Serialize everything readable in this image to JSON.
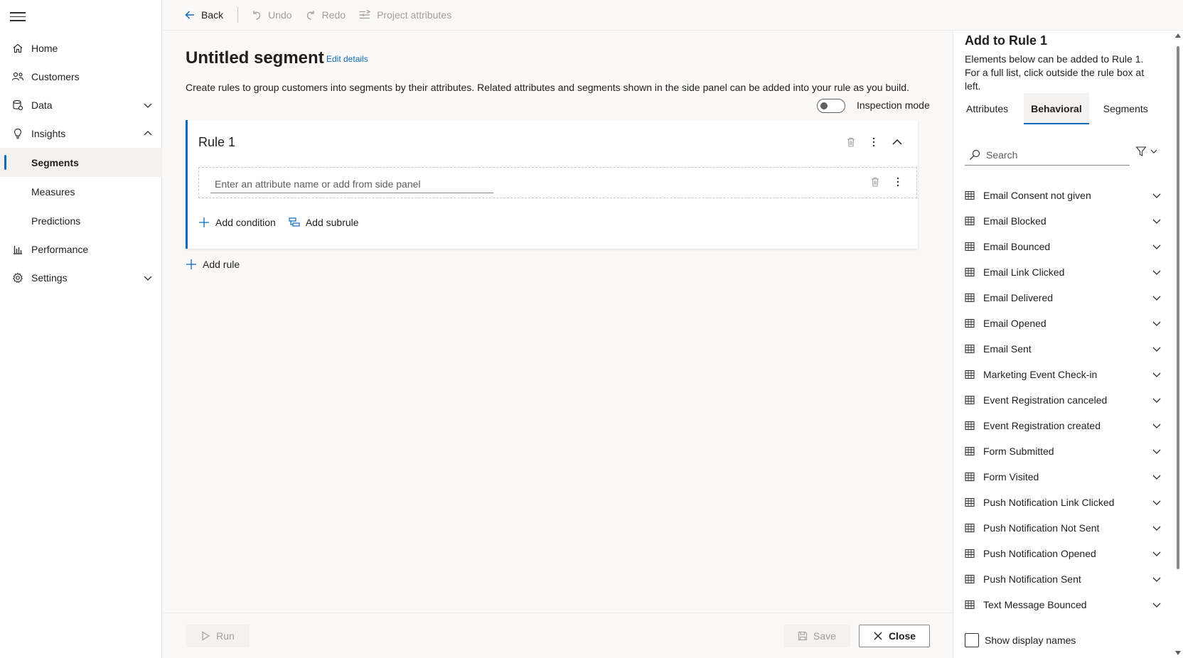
{
  "nav": {
    "items": [
      {
        "label": "Home",
        "icon": "home-icon"
      },
      {
        "label": "Customers",
        "icon": "people-icon"
      },
      {
        "label": "Data",
        "icon": "database-icon",
        "expandable": true
      },
      {
        "label": "Insights",
        "icon": "lightbulb-icon",
        "expanded": true
      },
      {
        "label": "Segments",
        "sub": true,
        "active": true
      },
      {
        "label": "Measures",
        "sub": true
      },
      {
        "label": "Predictions",
        "sub": true
      },
      {
        "label": "Performance",
        "icon": "bar-chart-icon"
      },
      {
        "label": "Settings",
        "icon": "gear-icon",
        "expandable": true
      }
    ]
  },
  "toolbar": {
    "back": "Back",
    "undo": "Undo",
    "redo": "Redo",
    "project_attributes": "Project attributes"
  },
  "main": {
    "title": "Untitled segment",
    "edit_details": "Edit details",
    "description": "Create rules to group customers into segments by their attributes. Related attributes and segments shown in the side panel can be added into your rule as you build.",
    "inspection_mode": "Inspection mode",
    "rule": {
      "title": "Rule 1",
      "condition_placeholder": "Enter an attribute name or add from side panel",
      "add_condition": "Add condition",
      "add_subrule": "Add subrule"
    },
    "add_rule": "Add rule"
  },
  "bottombar": {
    "run": "Run",
    "save": "Save",
    "close": "Close"
  },
  "panel": {
    "title": "Add to Rule 1",
    "description": "Elements below can be added to Rule 1. For a full list, click outside the rule box at left.",
    "tabs": [
      "Attributes",
      "Behavioral",
      "Segments"
    ],
    "active_tab": "Behavioral",
    "search_placeholder": "Search",
    "items": [
      "Email Consent not given",
      "Email Blocked",
      "Email Bounced",
      "Email Link Clicked",
      "Email Delivered",
      "Email Opened",
      "Email Sent",
      "Marketing Event Check-in",
      "Event Registration canceled",
      "Event Registration created",
      "Form Submitted",
      "Form Visited",
      "Push Notification Link Clicked",
      "Push Notification Not Sent",
      "Push Notification Opened",
      "Push Notification Sent",
      "Text Message Bounced"
    ],
    "show_display_names": "Show display names"
  },
  "colors": {
    "accent": "#0f6cbd",
    "text": "#201f1e",
    "disabled": "#a19f9d"
  }
}
